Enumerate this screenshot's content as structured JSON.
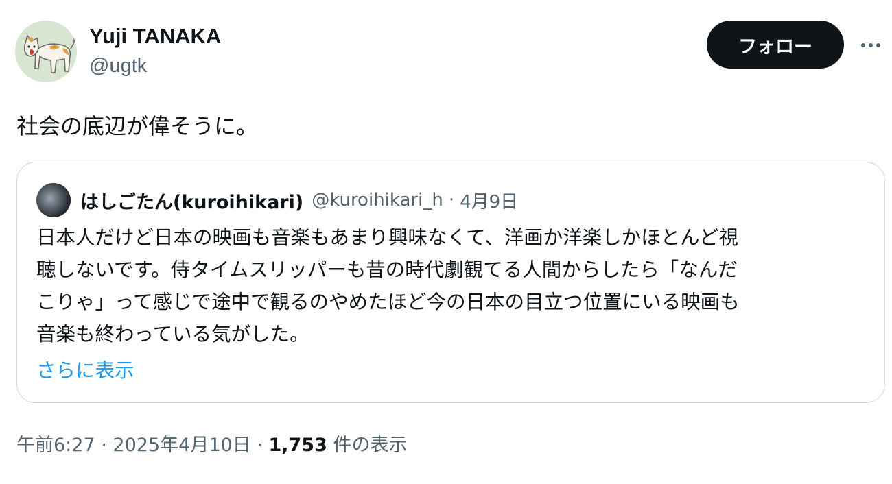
{
  "author": {
    "name": "Yuji TANAKA",
    "handle": "@ugtk"
  },
  "follow_label": "フォロー",
  "more_icon": "more-horizontal-icon",
  "tweet_text": "社会の底辺が偉そうに。",
  "quote": {
    "name": "はしごたん(kuroihikari)",
    "handle": "@kuroihikari_h",
    "separator": "·",
    "date": "4月9日",
    "lines": [
      "日本人だけど日本の映画も音楽もあまり興味なくて、洋画か洋楽しかほとんど視",
      "聴しないです。侍タイムスリッパーも昔の時代劇観てる人間からしたら「なんだ",
      "こりゃ」って感じで途中で観るのやめたほど今の日本の目立つ位置にいる映画も",
      "音楽も終わっている気がした。"
    ],
    "show_more": "さらに表示"
  },
  "meta": {
    "time": "午前6:27",
    "separator": "·",
    "date": "2025年4月10日",
    "views_count": "1,753",
    "views_label": "件の表示"
  },
  "colors": {
    "text": "#0f1419",
    "secondary": "#536471",
    "link": "#1d9bf0",
    "border": "#cfd9de",
    "button_bg": "#0f1419"
  }
}
